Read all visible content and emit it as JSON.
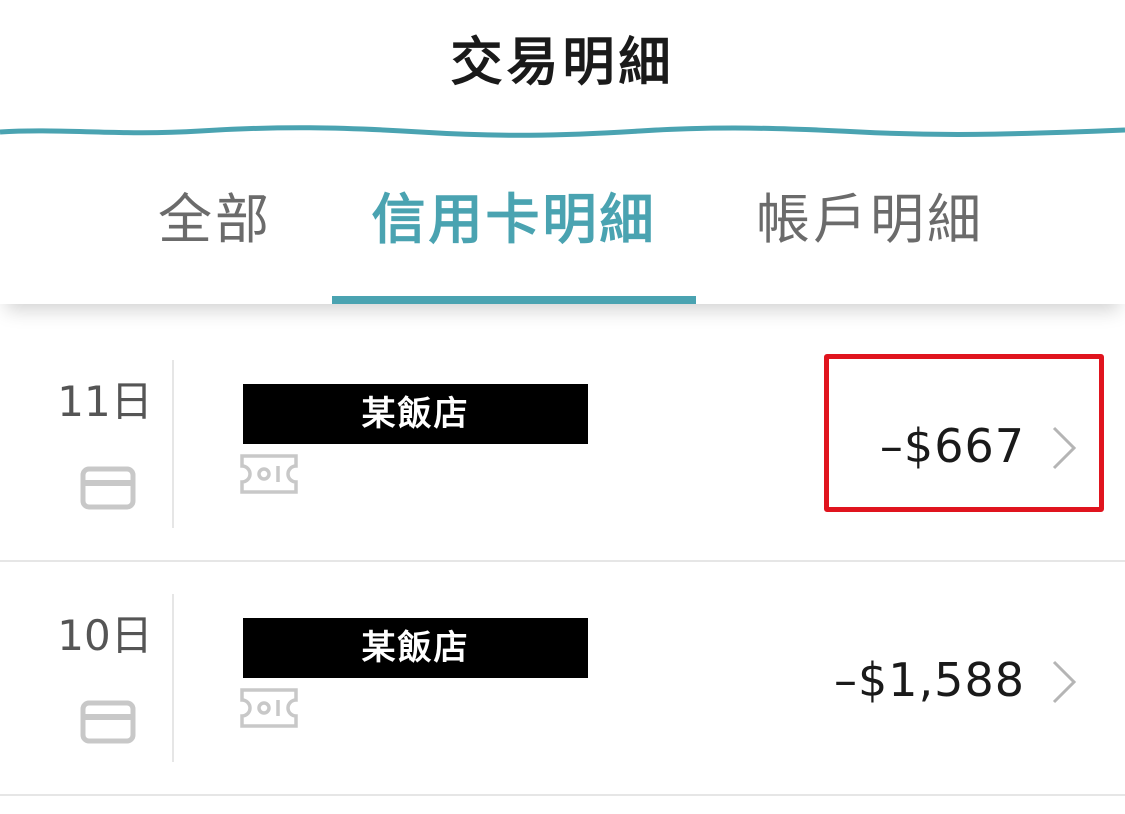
{
  "header": {
    "title": "交易明細"
  },
  "tabs": [
    {
      "label": "全部",
      "active": false
    },
    {
      "label": "信用卡明細",
      "active": true
    },
    {
      "label": "帳戶明細",
      "active": false
    }
  ],
  "transactions": [
    {
      "date": "11日",
      "merchant": "某飯店",
      "amount": "–$667",
      "type_icon": "credit-card-icon",
      "coupon_icon": "coupon-icon"
    },
    {
      "date": "10日",
      "merchant": "某飯店",
      "amount": "–$1,588",
      "type_icon": "credit-card-icon",
      "coupon_icon": "coupon-icon"
    }
  ],
  "colors": {
    "accent": "#4aa3b1",
    "highlight": "#e0141e",
    "text": "#1a1a1a",
    "muted": "#6b6b6b"
  }
}
